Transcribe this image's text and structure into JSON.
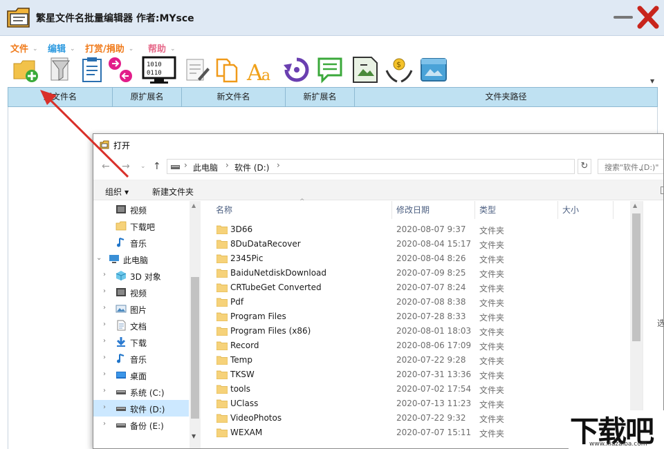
{
  "app": {
    "title": "繁星文件名批量编辑器  作者:MYsce",
    "menu": [
      {
        "label": "文件",
        "color": "#f07a1a"
      },
      {
        "label": "编辑",
        "color": "#2f9be0"
      },
      {
        "label": "打赏/捐助",
        "color": "#f07a1a"
      },
      {
        "label": "帮助",
        "color": "#e66a8a"
      }
    ],
    "toolbar_icons": [
      "add-folder-icon",
      "filter-funnel-icon",
      "clipboard-icon",
      "move-arrows-icon",
      "binary-monitor-icon",
      "edit-document-icon",
      "copy-files-icon",
      "font-case-icon",
      "undo-icon",
      "comment-icon",
      "rename-image-icon",
      "donate-hands-icon",
      "window-screenshot-icon"
    ],
    "columns": [
      "原文件名",
      "原扩展名",
      "新文件名",
      "新扩展名",
      "文件夹路径"
    ]
  },
  "dialog": {
    "title": "打开",
    "breadcrumbs": [
      "此电脑",
      "软件 (D:)"
    ],
    "search_placeholder": "搜索\"软件 (D:)\"",
    "commands": {
      "organize": "组织",
      "new_folder": "新建文件夹"
    },
    "nav_tree": [
      {
        "label": "视频",
        "icon": "video-icon",
        "expandable": false,
        "indent": 1
      },
      {
        "label": "下载吧",
        "icon": "folder-icon",
        "expandable": false,
        "indent": 1
      },
      {
        "label": "音乐",
        "icon": "music-icon",
        "expandable": false,
        "indent": 1
      },
      {
        "label": "此电脑",
        "icon": "computer-icon",
        "expandable": true,
        "expanded": true,
        "indent": 0
      },
      {
        "label": "3D 对象",
        "icon": "3d-objects-icon",
        "expandable": true,
        "indent": 1
      },
      {
        "label": "视频",
        "icon": "video-icon",
        "expandable": true,
        "indent": 1
      },
      {
        "label": "图片",
        "icon": "pictures-icon",
        "expandable": true,
        "indent": 1
      },
      {
        "label": "文档",
        "icon": "documents-icon",
        "expandable": true,
        "indent": 1
      },
      {
        "label": "下载",
        "icon": "download-icon",
        "expandable": true,
        "indent": 1
      },
      {
        "label": "音乐",
        "icon": "music-icon",
        "expandable": true,
        "indent": 1
      },
      {
        "label": "桌面",
        "icon": "desktop-icon",
        "expandable": true,
        "indent": 1
      },
      {
        "label": "系统 (C:)",
        "icon": "drive-icon",
        "expandable": true,
        "indent": 1
      },
      {
        "label": "软件 (D:)",
        "icon": "drive-icon",
        "expandable": true,
        "indent": 1,
        "selected": true
      },
      {
        "label": "备份 (E:)",
        "icon": "drive-icon",
        "expandable": true,
        "indent": 1
      }
    ],
    "file_columns": [
      "名称",
      "修改日期",
      "类型",
      "大小"
    ],
    "files": [
      {
        "name": "3D66",
        "date": "2020-08-07 9:37",
        "type": "文件夹"
      },
      {
        "name": "8DuDataRecover",
        "date": "2020-08-04 15:17",
        "type": "文件夹"
      },
      {
        "name": "2345Pic",
        "date": "2020-08-04 8:26",
        "type": "文件夹"
      },
      {
        "name": "BaiduNetdiskDownload",
        "date": "2020-07-09 8:25",
        "type": "文件夹"
      },
      {
        "name": "CRTubeGet Converted",
        "date": "2020-07-07 8:24",
        "type": "文件夹"
      },
      {
        "name": "Pdf",
        "date": "2020-07-08 8:38",
        "type": "文件夹"
      },
      {
        "name": "Program Files",
        "date": "2020-07-28 8:33",
        "type": "文件夹"
      },
      {
        "name": "Program Files (x86)",
        "date": "2020-08-01 18:03",
        "type": "文件夹"
      },
      {
        "name": "Record",
        "date": "2020-08-06 17:09",
        "type": "文件夹"
      },
      {
        "name": "Temp",
        "date": "2020-07-22 9:28",
        "type": "文件夹"
      },
      {
        "name": "TKSW",
        "date": "2020-07-31 13:36",
        "type": "文件夹"
      },
      {
        "name": "tools",
        "date": "2020-07-02 17:54",
        "type": "文件夹"
      },
      {
        "name": "UClass",
        "date": "2020-07-13 11:23",
        "type": "文件夹"
      },
      {
        "name": "VideoPhotos",
        "date": "2020-07-22 9:32",
        "type": "文件夹"
      },
      {
        "name": "WEXAM",
        "date": "2020-07-07 15:11",
        "type": "文件夹"
      }
    ],
    "preview_text": "选"
  },
  "watermark": {
    "text": "下载吧",
    "url": "www.xiazaiba.com"
  },
  "colors": {
    "titlebar": "#dfe9f4",
    "grid_header": "#bfe1f2",
    "annotation_arrow": "#d9302a",
    "selection": "#cce8ff"
  }
}
